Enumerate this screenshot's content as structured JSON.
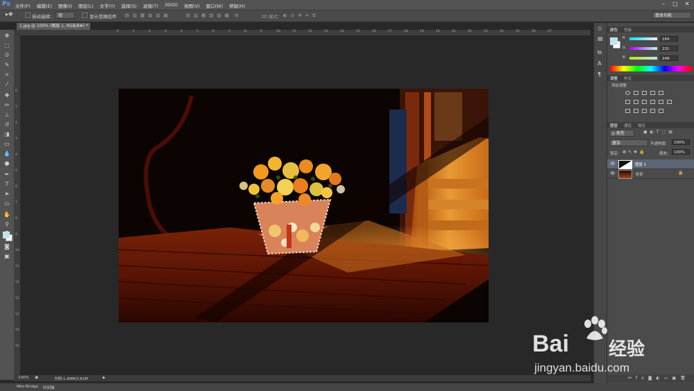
{
  "app": {
    "logo": "Ps"
  },
  "menu": [
    "文件(F)",
    "编辑(E)",
    "图像(I)",
    "图层(L)",
    "文字(Y)",
    "选择(S)",
    "滤镜(T)",
    "3D(D)",
    "视图(V)",
    "窗口(W)",
    "帮助(H)"
  ],
  "options_bar": {
    "auto_select_label": "自动选择：",
    "auto_select_value": "组",
    "show_transform_label": "显示变换控件",
    "mode_3d_label": "3D 模式：",
    "workspace": "基本功能"
  },
  "document": {
    "tab_title": "1.jpg @ 100% (图层 1, RGB/8#) *"
  },
  "rulers": {
    "top": [
      "0",
      "1",
      "2",
      "3",
      "4",
      "5",
      "6",
      "7",
      "8",
      "9",
      "10",
      "11",
      "12",
      "13",
      "14",
      "15",
      "16",
      "17",
      "18",
      "19",
      "20",
      "21",
      "22",
      "23",
      "24",
      "25",
      "26",
      "27"
    ],
    "left": [
      "0",
      "1",
      "2",
      "3",
      "4",
      "5",
      "6",
      "7",
      "8",
      "9",
      "10",
      "11",
      "12",
      "13",
      "14",
      "15",
      "16"
    ]
  },
  "status": {
    "zoom": "100%",
    "doc_info": "文档:1.89M/3.81M"
  },
  "bottom_panel": {
    "mini_bridge": "Mini Bridge",
    "timeline": "时间轴"
  },
  "color_panel": {
    "tabs": [
      "颜色",
      "色板"
    ],
    "channels": [
      {
        "name": "R",
        "value": "184"
      },
      {
        "name": "G",
        "value": "231"
      },
      {
        "name": "B",
        "value": "248"
      }
    ],
    "foreground": "#b8e7f8"
  },
  "adjust_panel": {
    "tabs": [
      "调整",
      "样式"
    ],
    "heading": "添加调整"
  },
  "layers_panel": {
    "tabs": [
      "图层",
      "通道",
      "路径"
    ],
    "filter_label": "ρ 类型",
    "blend_mode": "叠加",
    "opacity_label": "不透明度:",
    "opacity_value": "100%",
    "lock_label": "锁定:",
    "fill_label": "填充:",
    "fill_value": "100%",
    "layers": [
      {
        "name": "图层 1",
        "selected": true
      },
      {
        "name": "背景",
        "selected": false
      }
    ]
  },
  "watermark": {
    "brand": "Bai",
    "brand2": "经验",
    "url": "jingyan.baidu.com"
  }
}
